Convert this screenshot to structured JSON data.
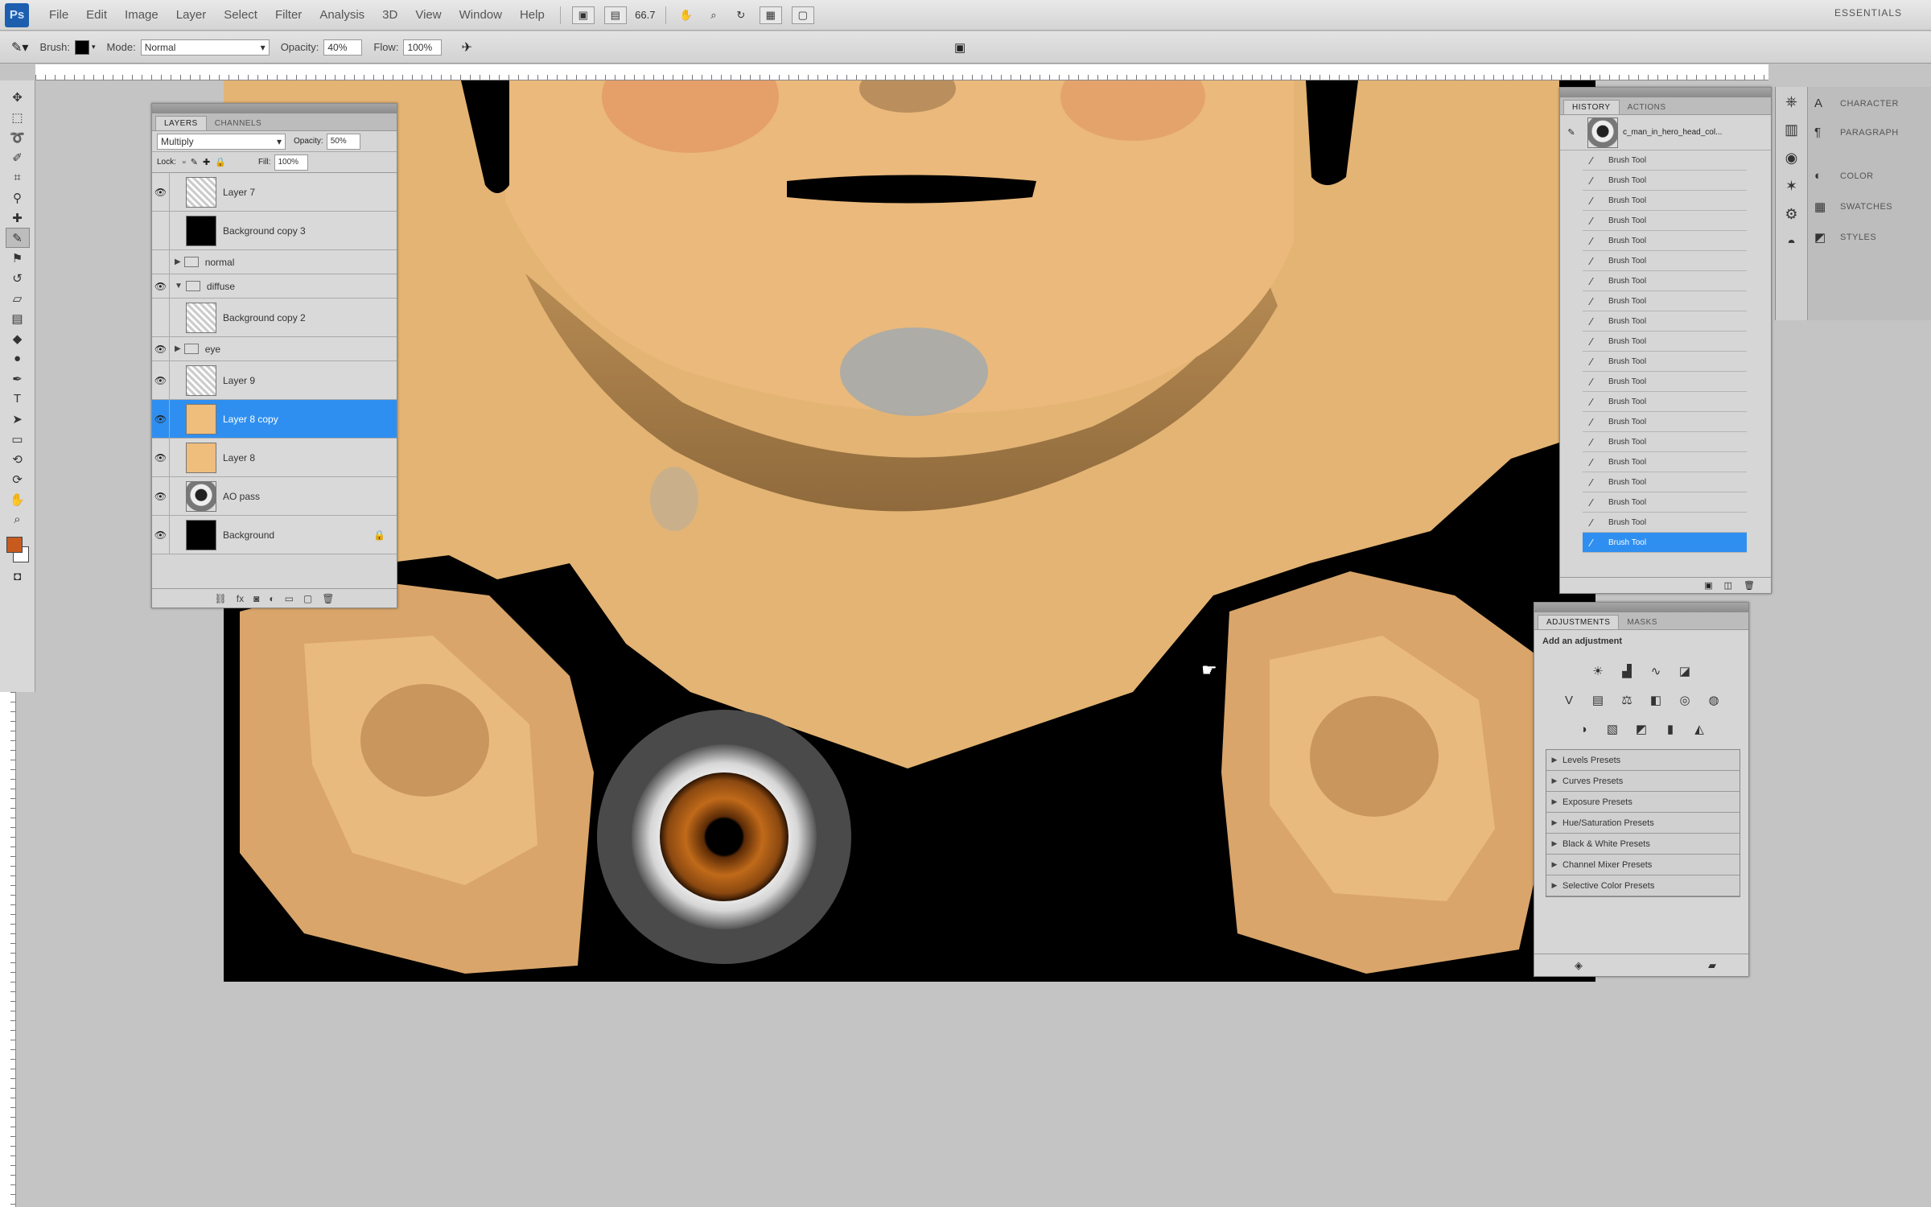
{
  "app": {
    "name": "Ps",
    "workspace": "ESSENTIALS"
  },
  "menu": [
    "File",
    "Edit",
    "Image",
    "Layer",
    "Select",
    "Filter",
    "Analysis",
    "3D",
    "View",
    "Window",
    "Help"
  ],
  "menubar_tools": {
    "zoom": "66.7"
  },
  "options": {
    "brush_label": "Brush:",
    "mode_label": "Mode:",
    "mode_value": "Normal",
    "opacity_label": "Opacity:",
    "opacity_value": "40%",
    "flow_label": "Flow:",
    "flow_value": "100%"
  },
  "tools": [
    "move-icon",
    "marquee-icon",
    "lasso-icon",
    "quick-select-icon",
    "crop-icon",
    "eyedropper-icon",
    "healing-icon",
    "brush-icon",
    "clone-stamp-icon",
    "history-brush-icon",
    "eraser-icon",
    "gradient-icon",
    "blur-icon",
    "dodge-icon",
    "pen-icon",
    "type-icon",
    "path-select-icon",
    "shape-icon",
    "3d-rotate-icon",
    "3d-orbit-icon",
    "hand-icon",
    "zoom-icon"
  ],
  "colors": {
    "foreground": "#c85a1d",
    "background": "#ffffff",
    "selection": "#2f8ff0",
    "skin": "#e6b677"
  },
  "layers_panel": {
    "tabs": [
      "LAYERS",
      "CHANNELS"
    ],
    "blend_mode": "Multiply",
    "opacity_label": "Opacity:",
    "opacity_value": "50%",
    "lock_label": "Lock:",
    "fill_label": "Fill:",
    "fill_value": "100%",
    "layers": [
      {
        "name": "Layer 7",
        "thumb": "texture",
        "visible": true
      },
      {
        "name": "Background copy 3",
        "thumb": "dark",
        "visible": false
      },
      {
        "name": "normal",
        "group": true,
        "visible": false
      },
      {
        "name": "diffuse",
        "group": true,
        "visible": true
      },
      {
        "name": "Background copy 2",
        "thumb": "texture",
        "visible": false
      },
      {
        "name": "eye",
        "group": true,
        "visible": true
      },
      {
        "name": "Layer 9",
        "thumb": "texture",
        "visible": true
      },
      {
        "name": "Layer 8 copy",
        "thumb": "skin",
        "visible": true,
        "selected": true
      },
      {
        "name": "Layer 8",
        "thumb": "skin",
        "visible": true
      },
      {
        "name": "AO pass",
        "thumb": "face",
        "visible": true
      },
      {
        "name": "Background",
        "thumb": "dark",
        "visible": true,
        "locked": true
      }
    ],
    "footer": "fx"
  },
  "history_panel": {
    "tabs": [
      "HISTORY",
      "ACTIONS"
    ],
    "snapshot": "c_man_in_hero_head_col...",
    "items": [
      "Brush Tool",
      "Brush Tool",
      "Brush Tool",
      "Brush Tool",
      "Brush Tool",
      "Brush Tool",
      "Brush Tool",
      "Brush Tool",
      "Brush Tool",
      "Brush Tool",
      "Brush Tool",
      "Brush Tool",
      "Brush Tool",
      "Brush Tool",
      "Brush Tool",
      "Brush Tool",
      "Brush Tool",
      "Brush Tool",
      "Brush Tool",
      "Brush Tool"
    ],
    "selected_index": 19
  },
  "right_dock": {
    "items": [
      "CHARACTER",
      "PARAGRAPH",
      "COLOR",
      "SWATCHES",
      "STYLES"
    ]
  },
  "adjustments_panel": {
    "tabs": [
      "ADJUSTMENTS",
      "MASKS"
    ],
    "header": "Add an adjustment",
    "presets": [
      "Levels Presets",
      "Curves Presets",
      "Exposure Presets",
      "Hue/Saturation Presets",
      "Black & White Presets",
      "Channel Mixer Presets",
      "Selective Color Presets"
    ]
  }
}
